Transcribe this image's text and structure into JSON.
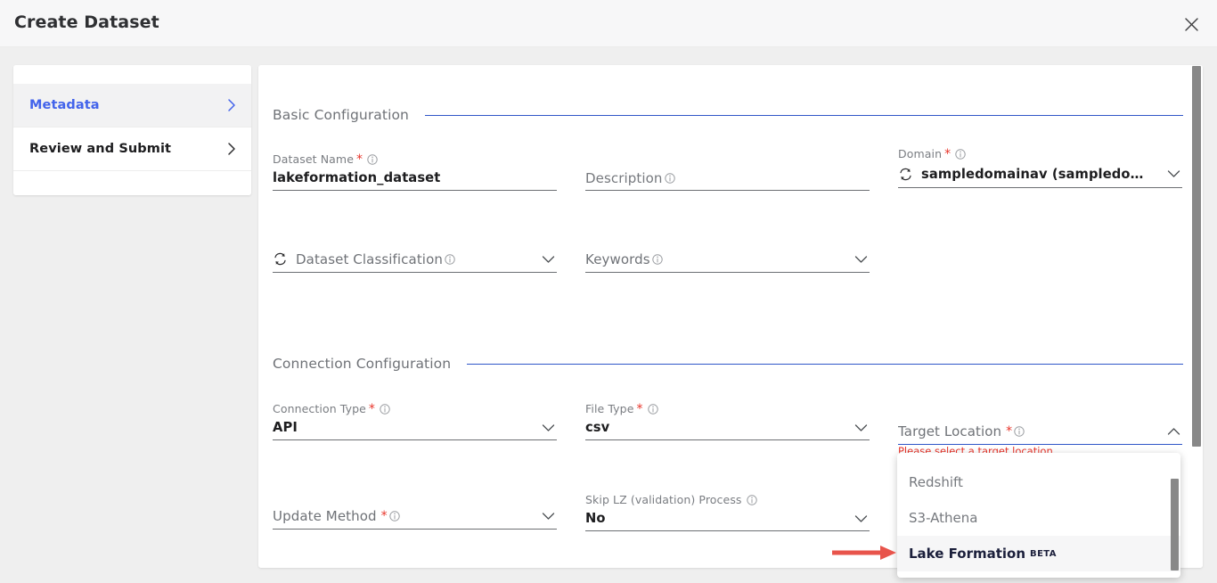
{
  "window": {
    "title": "Create Dataset",
    "close_icon": "close-icon"
  },
  "sidebar": {
    "items": [
      {
        "label": "Metadata",
        "active": true,
        "chevron_icon": "chevron-right-icon"
      },
      {
        "label": "Review and Submit",
        "active": false,
        "chevron_icon": "chevron-right-icon"
      }
    ]
  },
  "sections": {
    "basic": {
      "title": "Basic Configuration"
    },
    "connection": {
      "title": "Connection Configuration"
    }
  },
  "fields": {
    "dataset_name": {
      "label": "Dataset Name",
      "required": "*",
      "value": "lakeformation_dataset",
      "info_icon": "info-icon"
    },
    "description": {
      "label": "Description",
      "placeholder": "Description",
      "value": "",
      "info_icon": "info-icon"
    },
    "domain": {
      "label": "Domain",
      "required": "*",
      "value": "sampledomainav (sampledomain…",
      "info_icon": "info-icon",
      "refresh_icon": "refresh-icon",
      "chevron_icon": "chevron-down-icon"
    },
    "dataset_classification": {
      "label": "Dataset Classification",
      "placeholder": "Dataset Classification",
      "value": "",
      "info_icon": "info-icon",
      "refresh_icon": "refresh-icon",
      "chevron_icon": "chevron-down-icon"
    },
    "keywords": {
      "label": "Keywords",
      "placeholder": "Keywords",
      "value": "",
      "info_icon": "info-icon",
      "chevron_icon": "chevron-down-icon"
    },
    "connection_type": {
      "label": "Connection Type",
      "required": "*",
      "value": "API",
      "info_icon": "info-icon",
      "chevron_icon": "chevron-down-icon"
    },
    "file_type": {
      "label": "File Type",
      "required": "*",
      "value": "csv",
      "info_icon": "info-icon",
      "chevron_icon": "chevron-down-icon"
    },
    "target_location": {
      "label": "Target Location",
      "required": "*",
      "placeholder": "Target Location",
      "value": "",
      "info_icon": "info-icon",
      "chevron_icon": "chevron-up-icon",
      "error": "Please select a target location"
    },
    "update_method": {
      "label": "Update Method",
      "required": "*",
      "placeholder": "Update Method",
      "value": "",
      "info_icon": "info-icon",
      "chevron_icon": "chevron-down-icon"
    },
    "skip_lz": {
      "label": "Skip LZ (validation) Process",
      "value": "No",
      "info_icon": "info-icon",
      "chevron_icon": "chevron-down-icon"
    }
  },
  "dropdown": {
    "options": [
      {
        "label": "Redshift",
        "selected": false,
        "badge": ""
      },
      {
        "label": "S3-Athena",
        "selected": false,
        "badge": ""
      },
      {
        "label": "Lake Formation",
        "selected": true,
        "badge": "BETA"
      }
    ]
  },
  "annotation": {
    "arrow_icon": "right-arrow-annotation-icon",
    "color": "#e8544b"
  },
  "colors": {
    "accent_blue": "#3056c8",
    "link_blue": "#4263eb",
    "required_red": "#e8342a",
    "header_bg": "#f7f7f8",
    "page_bg": "#efefef",
    "card_bg": "#ffffff",
    "scrollbar": "#888888"
  }
}
